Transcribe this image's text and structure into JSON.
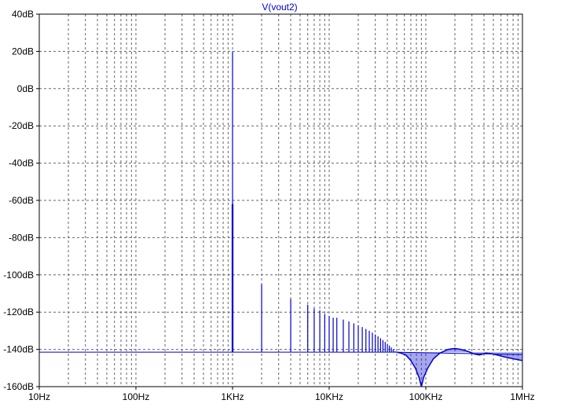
{
  "chart_data": {
    "type": "line",
    "title": "V(vout2)",
    "xlabel": "",
    "ylabel": "",
    "x_scale": "log",
    "xlim": [
      10,
      1000000
    ],
    "ylim": [
      -160,
      40
    ],
    "grid": true,
    "x_ticks": [
      {
        "value": 10,
        "label": "10Hz"
      },
      {
        "value": 100,
        "label": "100Hz"
      },
      {
        "value": 1000,
        "label": "1KHz"
      },
      {
        "value": 10000,
        "label": "10KHz"
      },
      {
        "value": 100000,
        "label": "100KHz"
      },
      {
        "value": 1000000,
        "label": "1MHz"
      }
    ],
    "y_ticks": [
      {
        "value": 40,
        "label": "40dB"
      },
      {
        "value": 20,
        "label": "20dB"
      },
      {
        "value": 0,
        "label": "0dB"
      },
      {
        "value": -20,
        "label": "-20dB"
      },
      {
        "value": -40,
        "label": "-40dB"
      },
      {
        "value": -60,
        "label": "-60dB"
      },
      {
        "value": -80,
        "label": "-80dB"
      },
      {
        "value": -100,
        "label": "-100dB"
      },
      {
        "value": -120,
        "label": "-120dB"
      },
      {
        "value": -140,
        "label": "-140dB"
      },
      {
        "value": -160,
        "label": "-160dB"
      }
    ],
    "series": [
      {
        "name": "V(vout2)",
        "color": "#0000cc",
        "noise_floor_db": -141.5,
        "peaks": [
          {
            "x": 990,
            "y": -62
          },
          {
            "x": 1000,
            "y": 20
          },
          {
            "x": 1010,
            "y": -62
          },
          {
            "x": 2000,
            "y": -105
          },
          {
            "x": 3000,
            "y": -141
          },
          {
            "x": 4000,
            "y": -113
          },
          {
            "x": 6000,
            "y": -116
          },
          {
            "x": 7000,
            "y": -118
          },
          {
            "x": 8000,
            "y": -119
          },
          {
            "x": 9000,
            "y": -121
          },
          {
            "x": 10000,
            "y": -122
          },
          {
            "x": 11000,
            "y": -123
          },
          {
            "x": 12000,
            "y": -123
          },
          {
            "x": 14000,
            "y": -124
          },
          {
            "x": 16000,
            "y": -125
          },
          {
            "x": 18000,
            "y": -126
          },
          {
            "x": 20000,
            "y": -127
          },
          {
            "x": 22000,
            "y": -128
          },
          {
            "x": 24000,
            "y": -129
          },
          {
            "x": 26000,
            "y": -130
          },
          {
            "x": 28000,
            "y": -131
          },
          {
            "x": 30000,
            "y": -132
          },
          {
            "x": 32000,
            "y": -133
          },
          {
            "x": 34000,
            "y": -134
          },
          {
            "x": 36000,
            "y": -135
          },
          {
            "x": 38000,
            "y": -136
          },
          {
            "x": 40000,
            "y": -137
          },
          {
            "x": 42000,
            "y": -138
          },
          {
            "x": 44000,
            "y": -139
          },
          {
            "x": 46000,
            "y": -140
          },
          {
            "x": 48000,
            "y": -141
          }
        ],
        "tail": [
          {
            "x": 50000,
            "y": -141.5
          },
          {
            "x": 55000,
            "y": -142
          },
          {
            "x": 62000,
            "y": -143
          },
          {
            "x": 70000,
            "y": -146
          },
          {
            "x": 78000,
            "y": -150
          },
          {
            "x": 85000,
            "y": -155
          },
          {
            "x": 90000,
            "y": -160
          },
          {
            "x": 95000,
            "y": -155
          },
          {
            "x": 105000,
            "y": -150
          },
          {
            "x": 120000,
            "y": -145
          },
          {
            "x": 140000,
            "y": -142
          },
          {
            "x": 170000,
            "y": -140
          },
          {
            "x": 200000,
            "y": -139.5
          },
          {
            "x": 230000,
            "y": -140
          },
          {
            "x": 270000,
            "y": -141
          },
          {
            "x": 320000,
            "y": -142.5
          },
          {
            "x": 360000,
            "y": -143
          },
          {
            "x": 420000,
            "y": -142
          },
          {
            "x": 500000,
            "y": -142.5
          },
          {
            "x": 650000,
            "y": -144
          },
          {
            "x": 800000,
            "y": -145
          },
          {
            "x": 1000000,
            "y": -146
          }
        ]
      }
    ]
  }
}
